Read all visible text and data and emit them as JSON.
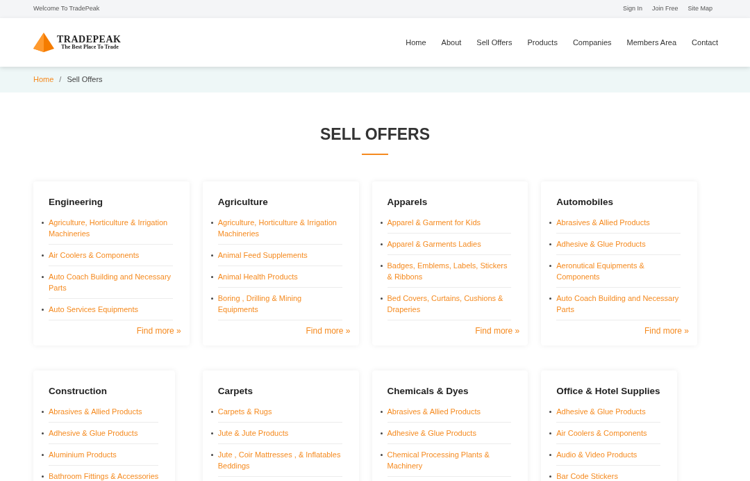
{
  "top_bar": {
    "welcome": "Welcome To TradePeak",
    "links": [
      "Sign In",
      "Join Free",
      "Site Map"
    ]
  },
  "header": {
    "logo": {
      "name": "TRADEPEAK",
      "tagline": "The Best Place To Trade"
    },
    "nav": [
      {
        "label": "Home",
        "selected": false
      },
      {
        "label": "About",
        "selected": false
      },
      {
        "label": "Sell Offers",
        "selected": false
      },
      {
        "label": "Products",
        "selected": false
      },
      {
        "label": "Companies",
        "selected": false
      },
      {
        "label": "Members Area",
        "selected": false
      },
      {
        "label": "Contact",
        "selected": false
      }
    ]
  },
  "breadcrumb": {
    "items": [
      "Home",
      "Sell Offers"
    ],
    "separator": "/"
  },
  "title": "SELL OFFERS",
  "categories": [
    {
      "name": "Engineering",
      "items": [
        "Agriculture, Horticulture & Irrigation Machineries",
        "Air Coolers & Components",
        "Auto Coach Building and Necessary Parts",
        "Auto Services Equipments"
      ],
      "more": "Find more »"
    },
    {
      "name": "Agriculture",
      "items": [
        "Agriculture, Horticulture & Irrigation Machineries",
        "Animal Feed Supplements",
        "Animal Health Products",
        "Boring , Drilling & Mining Equipments"
      ],
      "more": "Find more »"
    },
    {
      "name": "Apparels",
      "items": [
        "Apparel & Garment for Kids",
        "Apparel & Garments Ladies",
        "Badges, Emblems, Labels, Stickers & Ribbons",
        "Bed Covers, Curtains, Cushions & Draperies"
      ],
      "more": "Find more »"
    },
    {
      "name": "Automobiles",
      "items": [
        "Abrasives & Allied Products",
        "Adhesive & Glue Products",
        "Aeronutical Equipments & Components",
        "Auto Coach Building and Necessary Parts"
      ],
      "more": "Find more »"
    },
    {
      "name": "Construction",
      "items": [
        "Abrasives & Allied Products",
        "Adhesive & Glue Products",
        "Aluminium Products",
        "Bathroom Fittings & Accessories"
      ]
    },
    {
      "name": "Carpets",
      "items": [
        "Carpets & Rugs",
        "Jute & Jute Products",
        "Jute , Coir Mattresses , & Inflatables Beddings"
      ]
    },
    {
      "name": "Chemicals & Dyes",
      "items": [
        "Abrasives & Allied Products",
        "Adhesive & Glue Products",
        "Chemical Processing Plants & Machinery"
      ]
    },
    {
      "name": "Office & Hotel Supplies",
      "items": [
        "Adhesive & Glue Products",
        "Air Coolers & Components",
        "Audio & Video Products",
        "Bar Code Stickers"
      ]
    }
  ]
}
